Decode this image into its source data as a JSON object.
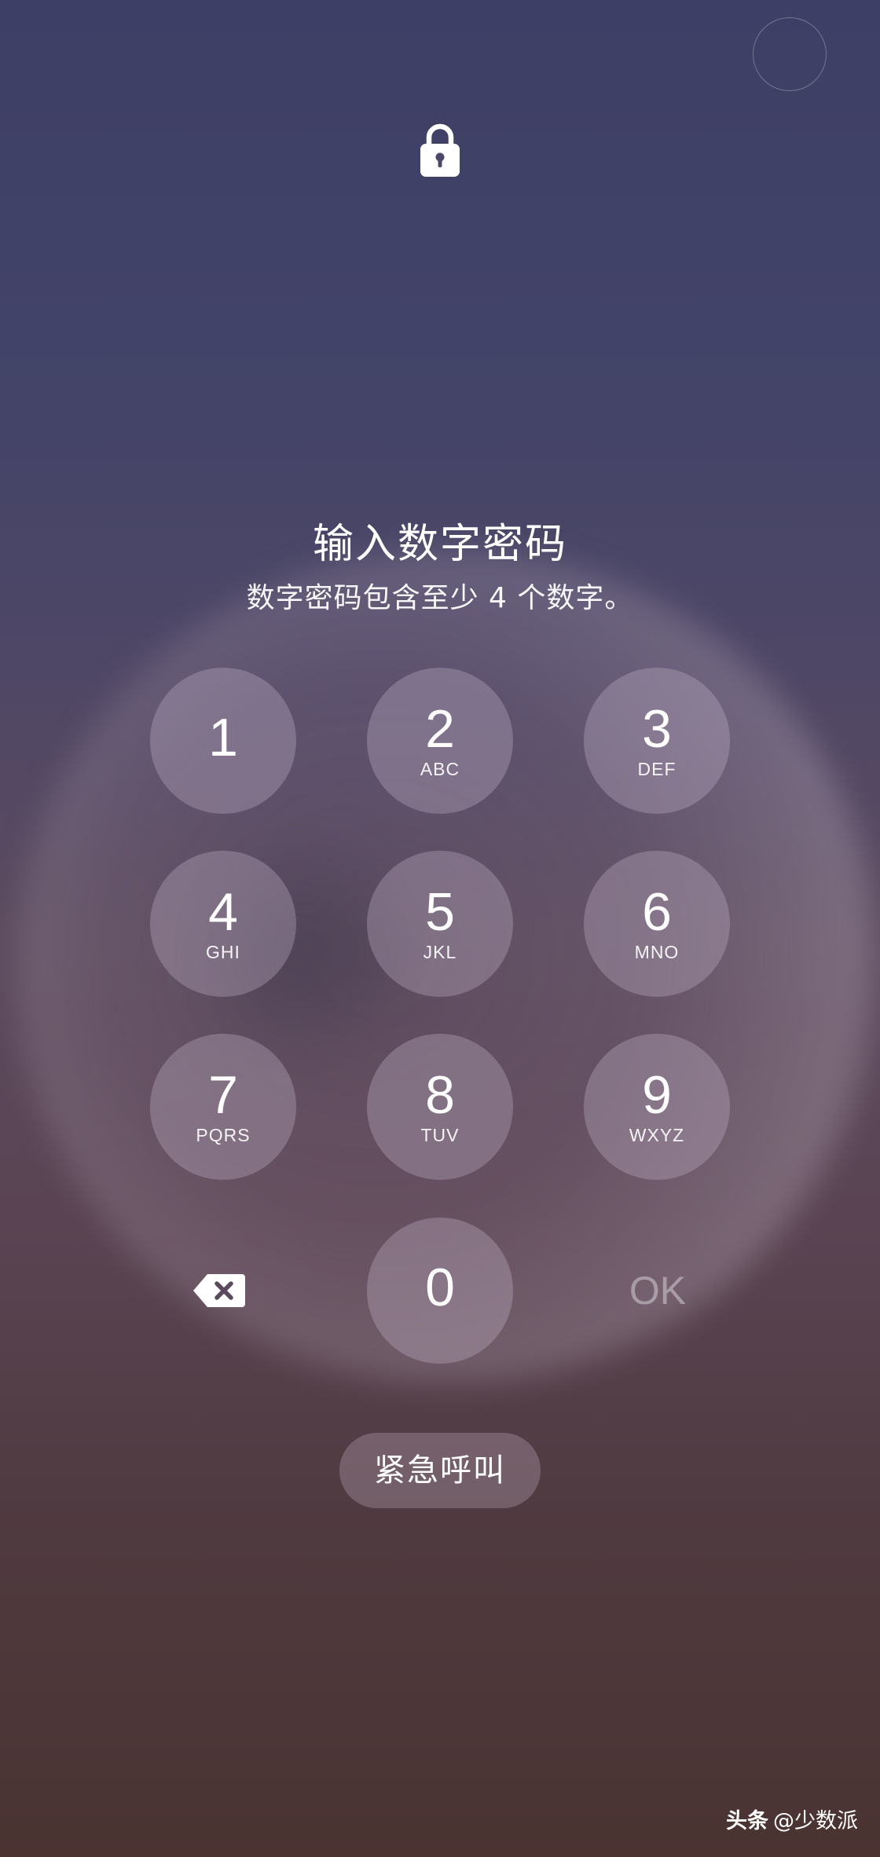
{
  "header": {
    "lock_icon": "lock-icon"
  },
  "prompt": {
    "title": "输入数字密码",
    "subtitle": "数字密码包含至少 4 个数字。"
  },
  "keypad": {
    "keys": [
      {
        "digit": "1",
        "letters": ""
      },
      {
        "digit": "2",
        "letters": "ABC"
      },
      {
        "digit": "3",
        "letters": "DEF"
      },
      {
        "digit": "4",
        "letters": "GHI"
      },
      {
        "digit": "5",
        "letters": "JKL"
      },
      {
        "digit": "6",
        "letters": "MNO"
      },
      {
        "digit": "7",
        "letters": "PQRS"
      },
      {
        "digit": "8",
        "letters": "TUV"
      },
      {
        "digit": "9",
        "letters": "WXYZ"
      },
      {
        "digit": "0",
        "letters": ""
      }
    ],
    "backspace_icon": "backspace-icon",
    "ok_label": "OK"
  },
  "emergency_call": {
    "label": "紧急呼叫"
  },
  "watermark": {
    "logo": "头条",
    "handle": "@少数派"
  },
  "colors": {
    "background_top": "#3e3f66",
    "background_bottom": "#4a3331",
    "key_fill": "rgba(200,185,205,0.32)",
    "text": "#ffffff"
  }
}
